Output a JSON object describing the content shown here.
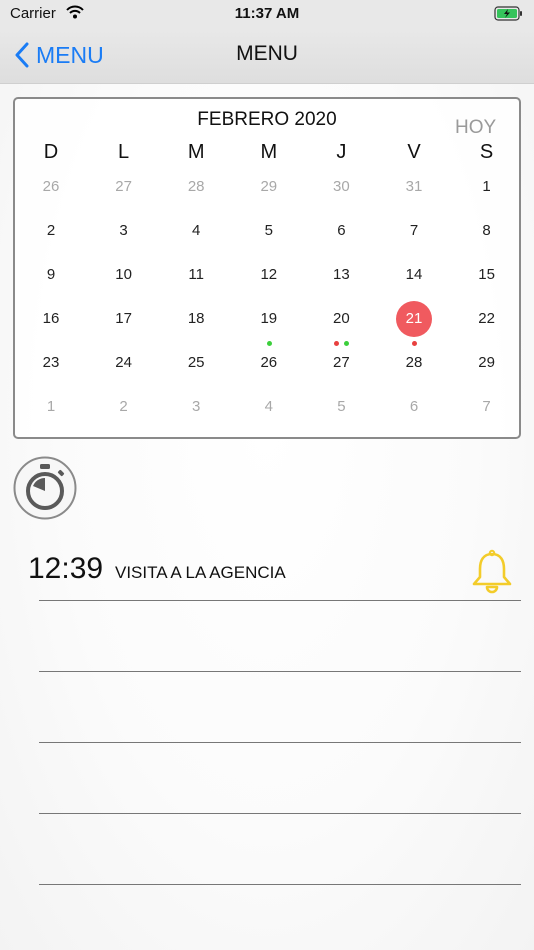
{
  "status": {
    "carrier": "Carrier",
    "time": "11:37 AM"
  },
  "nav": {
    "back_label": "MENU",
    "title": "MENU"
  },
  "calendar": {
    "month_label": "FEBRERO 2020",
    "today_button": "HOY",
    "weekdays": [
      "D",
      "L",
      "M",
      "M",
      "J",
      "V",
      "S"
    ],
    "weeks": [
      [
        "26",
        "27",
        "28",
        "29",
        "30",
        "31",
        "1"
      ],
      [
        "2",
        "3",
        "4",
        "5",
        "6",
        "7",
        "8"
      ],
      [
        "9",
        "10",
        "11",
        "12",
        "13",
        "14",
        "15"
      ],
      [
        "16",
        "17",
        "18",
        "19",
        "20",
        "21",
        "22"
      ],
      [
        "23",
        "24",
        "25",
        "26",
        "27",
        "28",
        "29"
      ],
      [
        "1",
        "2",
        "3",
        "4",
        "5",
        "6",
        "7"
      ]
    ],
    "selected_day": "21",
    "event_markers": [
      {
        "day": "19",
        "colors": [
          "#3ccf3c"
        ]
      },
      {
        "day": "20",
        "colors": [
          "#e8403f",
          "#3ccf3c"
        ]
      },
      {
        "day": "21",
        "colors": [
          "#e8403f"
        ]
      }
    ]
  },
  "events": [
    {
      "time": "12:39",
      "title": "VISITA A LA AGENCIA",
      "alarm_color": "#f3cc2a"
    }
  ]
}
